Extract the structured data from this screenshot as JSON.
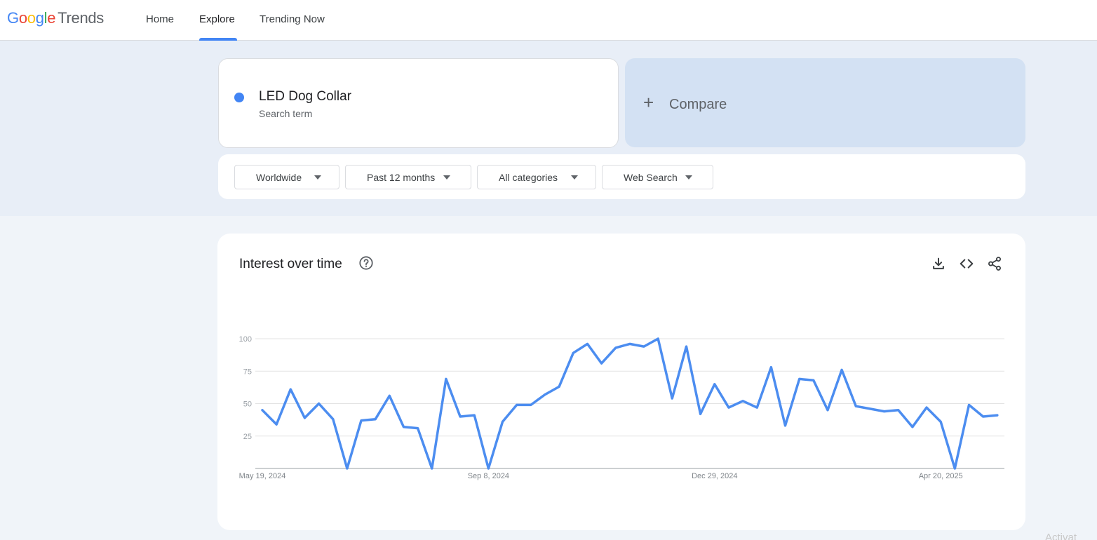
{
  "header": {
    "logo_google": "Google",
    "logo_trends": "Trends",
    "nav": [
      {
        "label": "Home",
        "active": false
      },
      {
        "label": "Explore",
        "active": true
      },
      {
        "label": "Trending Now",
        "active": false
      }
    ]
  },
  "search_term": {
    "name": "LED Dog Collar",
    "subtitle": "Search term",
    "color": "#4285f4"
  },
  "compare": {
    "icon": "plus-icon",
    "label": "Compare"
  },
  "filters": [
    {
      "label": "Worldwide"
    },
    {
      "label": "Past 12 months"
    },
    {
      "label": "All categories"
    },
    {
      "label": "Web Search"
    }
  ],
  "chart_card": {
    "title": "Interest over time",
    "icons": [
      "help-icon",
      "download-icon",
      "embed-code-icon",
      "share-icon"
    ]
  },
  "chart_data": {
    "type": "line",
    "title": "Interest over time",
    "xlabel": "",
    "ylabel": "",
    "ylim": [
      0,
      100
    ],
    "yticks": [
      25,
      50,
      75,
      100
    ],
    "x_tick_labels": [
      {
        "label": "May 19, 2024",
        "index": 0
      },
      {
        "label": "Sep 8, 2024",
        "index": 16
      },
      {
        "label": "Dec 29, 2024",
        "index": 32
      },
      {
        "label": "Apr 20, 2025",
        "index": 48
      }
    ],
    "grid": true,
    "series": [
      {
        "color": "#4c8df0",
        "values": [
          45,
          34,
          61,
          39,
          50,
          38,
          0,
          37,
          38,
          56,
          32,
          31,
          0,
          69,
          40,
          41,
          0,
          36,
          49,
          49,
          57,
          63,
          89,
          96,
          81,
          93,
          96,
          94,
          100,
          54,
          94,
          42,
          65,
          47,
          52,
          47,
          78,
          33,
          69,
          68,
          45,
          76,
          48,
          46,
          44,
          45,
          32,
          47,
          36,
          0,
          49,
          40,
          41
        ]
      }
    ]
  },
  "watermark": "Activat"
}
